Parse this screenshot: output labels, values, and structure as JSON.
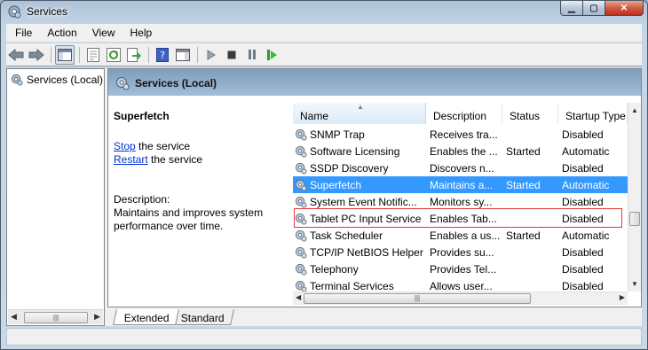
{
  "window": {
    "title": "Services",
    "minimize": "▁",
    "maximize": "▢",
    "close": "✕"
  },
  "menu": [
    "File",
    "Action",
    "View",
    "Help"
  ],
  "toolbar": {
    "buttons": [
      "back-icon",
      "forward-icon",
      "show-hide-console-tree-icon",
      "properties-icon",
      "refresh-icon",
      "export-list-icon",
      "help-icon",
      "show-action-pane-icon",
      "start-service-icon",
      "stop-service-icon",
      "pause-service-icon",
      "restart-service-icon"
    ]
  },
  "tree": {
    "item": "Services (Local)"
  },
  "panel": {
    "header": "Services (Local)"
  },
  "info": {
    "title": "Superfetch",
    "stop_link": "Stop",
    "stop_rest": " the service",
    "restart_link": "Restart",
    "restart_rest": " the service",
    "desc_label": "Description:",
    "desc_text": "Maintains and improves system performance over time."
  },
  "columns": {
    "name": "Name",
    "description": "Description",
    "status": "Status",
    "startup": "Startup Type"
  },
  "rows": [
    {
      "name": "SNMP Trap",
      "description": "Receives tra...",
      "status": "",
      "startup": "Disabled"
    },
    {
      "name": "Software Licensing",
      "description": "Enables the ...",
      "status": "Started",
      "startup": "Automatic"
    },
    {
      "name": "SSDP Discovery",
      "description": "Discovers n...",
      "status": "",
      "startup": "Disabled"
    },
    {
      "name": "Superfetch",
      "description": "Maintains a...",
      "status": "Started",
      "startup": "Automatic"
    },
    {
      "name": "System Event Notific...",
      "description": "Monitors sy...",
      "status": "",
      "startup": "Disabled"
    },
    {
      "name": "Tablet PC Input Service",
      "description": "Enables Tab...",
      "status": "",
      "startup": "Disabled"
    },
    {
      "name": "Task Scheduler",
      "description": "Enables a us...",
      "status": "Started",
      "startup": "Automatic"
    },
    {
      "name": "TCP/IP NetBIOS Helper",
      "description": "Provides su...",
      "status": "",
      "startup": "Disabled"
    },
    {
      "name": "Telephony",
      "description": "Provides Tel...",
      "status": "",
      "startup": "Disabled"
    },
    {
      "name": "Terminal Services",
      "description": "Allows user...",
      "status": "",
      "startup": "Disabled"
    }
  ],
  "tabs": {
    "extended": "Extended",
    "standard": "Standard"
  },
  "colors": {
    "selection": "#3399ff",
    "header_gradient_top": "#7d9ebd",
    "link": "#0033cc"
  }
}
